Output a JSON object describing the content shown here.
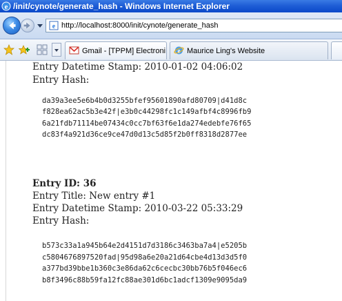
{
  "window": {
    "title": "/init/cynote/generate_hash - Windows Internet Explorer"
  },
  "address": {
    "url": "http://localhost:8000/init/cynote/generate_hash"
  },
  "tabs": [
    {
      "label": "Gmail - [TPPM] Electroni..."
    },
    {
      "label": "Maurice Ling's Website"
    }
  ],
  "entries": [
    {
      "datetime_label": "Entry Datetime Stamp: 2010-01-02 04:06:02",
      "hash_label": "Entry Hash:",
      "hash_lines": [
        "da39a3ee5e6b4b0d3255bfef95601890afd80709|d41d8c",
        "f828ea62ac5b3e42f|e3b0c44298fc1c149afbf4c8996fb9",
        "6a21fdb71114be07434c0cc7bf63f6e1da274edebfe76f65",
        "dc83f4a921d36ce9ce47d0d13c5d85f2b0ff8318d2877ee"
      ]
    },
    {
      "id_label": "Entry ID: 36",
      "title_label": "Entry Title: New entry #1",
      "datetime_label": "Entry Datetime Stamp: 2010-03-22 05:33:29",
      "hash_label": "Entry Hash:",
      "hash_lines": [
        "b573c33a1a945b64e2d4151d7d3186c3463ba7a4|e5205b",
        "c5804676897520fad|95d98a6e20a21d64cbe4d13d3d5f0",
        "a377bd39bbe1b360c3e86da62c6cecbc30bb76b5f046ec6",
        "b8f3496c88b59fa12fc88ae301d6bc1adcf1309e9095da9"
      ]
    }
  ],
  "colors": {
    "titlebar": "#0a49c9",
    "toolbar": "#c9daf1"
  },
  "icons": [
    "ie-icon",
    "back-icon",
    "forward-icon",
    "page-icon",
    "favorites-star-icon",
    "add-favorite-icon",
    "quick-tabs-icon",
    "gmail-icon",
    "ie-tab-icon"
  ]
}
